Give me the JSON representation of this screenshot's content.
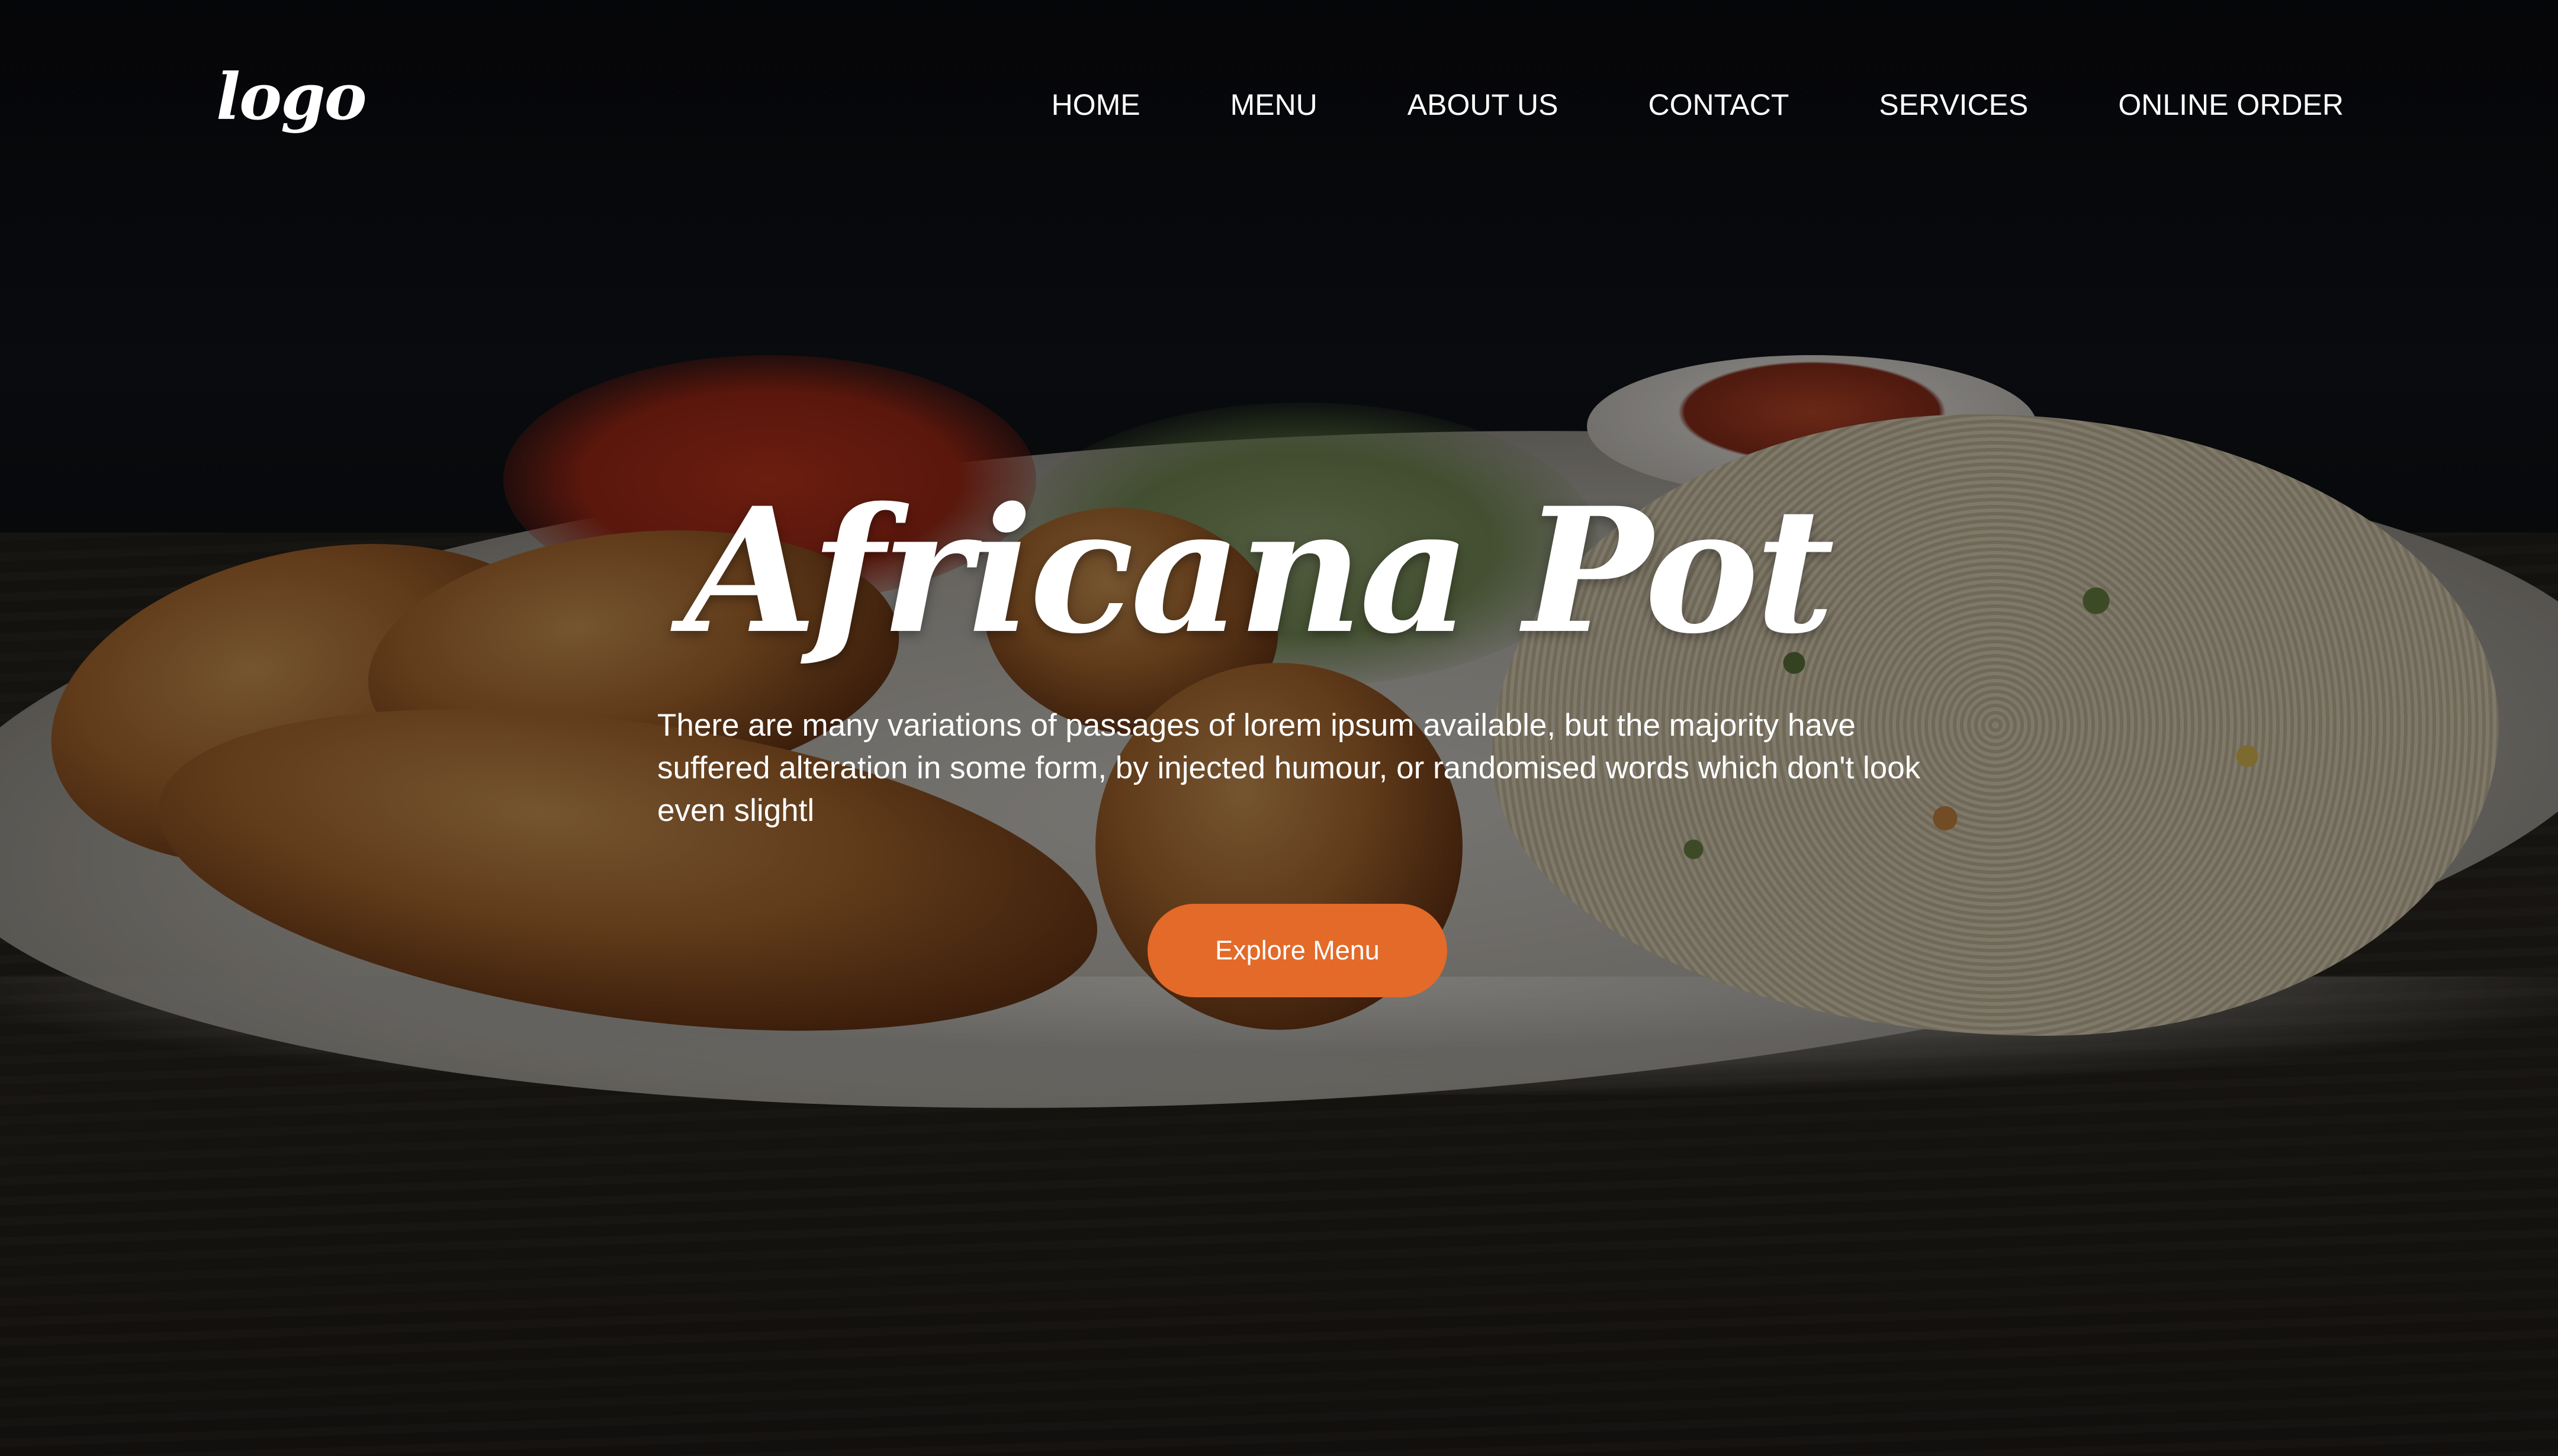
{
  "brand": {
    "logo_text": "logo"
  },
  "nav": {
    "items": [
      {
        "label": "HOME"
      },
      {
        "label": "MENU"
      },
      {
        "label": "ABOUT US"
      },
      {
        "label": "CONTACT"
      },
      {
        "label": "SERVICES"
      },
      {
        "label": "ONLINE ORDER"
      }
    ]
  },
  "hero": {
    "title": "Africana Pot",
    "description": "There are many variations of passages of lorem ipsum available, but the majority have suffered alteration in some form, by injected humour, or randomised words which don't look even slightl",
    "cta_label": "Explore Menu",
    "background_image": "food-plate-chicken-jollof-rice-photo"
  },
  "colors": {
    "accent": "#e36a28",
    "text": "#ffffff",
    "overlay": "#000000"
  }
}
